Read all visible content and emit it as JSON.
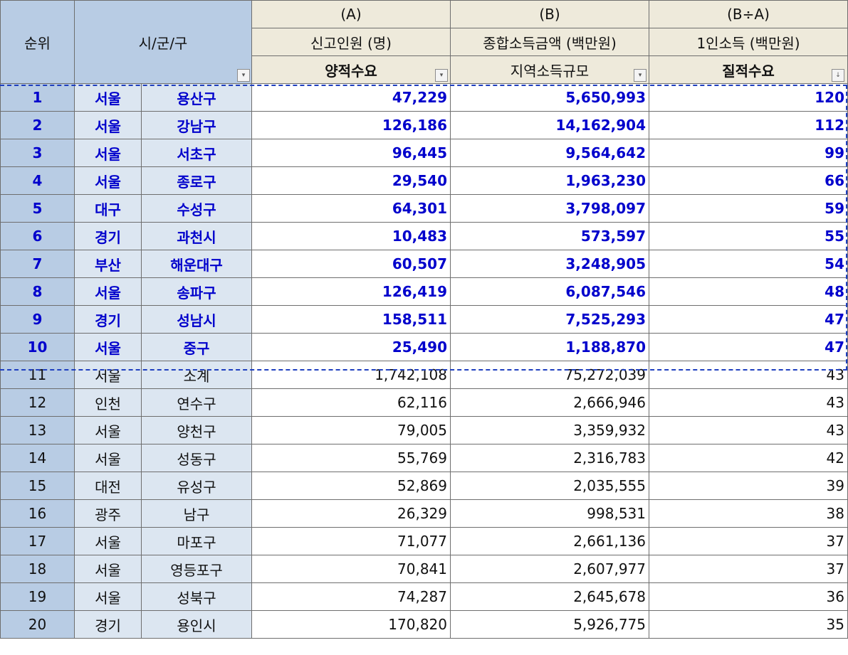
{
  "header": {
    "rank_label": "순위",
    "region_label": "시/군/구",
    "col_a": {
      "code": "(A)",
      "title": "신고인원 (명)",
      "subtitle": "양적수요"
    },
    "col_b": {
      "code": "(B)",
      "title": "종합소득금액 (백만원)",
      "subtitle": "지역소득규모"
    },
    "col_c": {
      "code": "(B÷A)",
      "title": "1인소득 (백만원)",
      "subtitle": "질적수요"
    },
    "filter_icons": {
      "region": "filter-dropdown-icon",
      "a": "filter-dropdown-icon",
      "b": "filter-dropdown-icon",
      "c": "sort-descending-icon"
    },
    "filter_glyph": "▾",
    "sort_glyph": "↓"
  },
  "rows": [
    {
      "rank": "1",
      "city": "서울",
      "district": "용산구",
      "a": "47,229",
      "b": "5,650,993",
      "c": "120"
    },
    {
      "rank": "2",
      "city": "서울",
      "district": "강남구",
      "a": "126,186",
      "b": "14,162,904",
      "c": "112"
    },
    {
      "rank": "3",
      "city": "서울",
      "district": "서초구",
      "a": "96,445",
      "b": "9,564,642",
      "c": "99"
    },
    {
      "rank": "4",
      "city": "서울",
      "district": "종로구",
      "a": "29,540",
      "b": "1,963,230",
      "c": "66"
    },
    {
      "rank": "5",
      "city": "대구",
      "district": "수성구",
      "a": "64,301",
      "b": "3,798,097",
      "c": "59"
    },
    {
      "rank": "6",
      "city": "경기",
      "district": "과천시",
      "a": "10,483",
      "b": "573,597",
      "c": "55"
    },
    {
      "rank": "7",
      "city": "부산",
      "district": "해운대구",
      "a": "60,507",
      "b": "3,248,905",
      "c": "54"
    },
    {
      "rank": "8",
      "city": "서울",
      "district": "송파구",
      "a": "126,419",
      "b": "6,087,546",
      "c": "48"
    },
    {
      "rank": "9",
      "city": "경기",
      "district": "성남시",
      "a": "158,511",
      "b": "7,525,293",
      "c": "47"
    },
    {
      "rank": "10",
      "city": "서울",
      "district": "중구",
      "a": "25,490",
      "b": "1,188,870",
      "c": "47"
    },
    {
      "rank": "11",
      "city": "서울",
      "district": "소계",
      "a": "1,742,108",
      "b": "75,272,039",
      "c": "43"
    },
    {
      "rank": "12",
      "city": "인천",
      "district": "연수구",
      "a": "62,116",
      "b": "2,666,946",
      "c": "43"
    },
    {
      "rank": "13",
      "city": "서울",
      "district": "양천구",
      "a": "79,005",
      "b": "3,359,932",
      "c": "43"
    },
    {
      "rank": "14",
      "city": "서울",
      "district": "성동구",
      "a": "55,769",
      "b": "2,316,783",
      "c": "42"
    },
    {
      "rank": "15",
      "city": "대전",
      "district": "유성구",
      "a": "52,869",
      "b": "2,035,555",
      "c": "39"
    },
    {
      "rank": "16",
      "city": "광주",
      "district": "남구",
      "a": "26,329",
      "b": "998,531",
      "c": "38"
    },
    {
      "rank": "17",
      "city": "서울",
      "district": "마포구",
      "a": "71,077",
      "b": "2,661,136",
      "c": "37"
    },
    {
      "rank": "18",
      "city": "서울",
      "district": "영등포구",
      "a": "70,841",
      "b": "2,607,977",
      "c": "37"
    },
    {
      "rank": "19",
      "city": "서울",
      "district": "성북구",
      "a": "74,287",
      "b": "2,645,678",
      "c": "36"
    },
    {
      "rank": "20",
      "city": "경기",
      "district": "용인시",
      "a": "170,820",
      "b": "5,926,775",
      "c": "35"
    }
  ],
  "highlight": {
    "top_rows": 10,
    "text_color": "#0000cc",
    "border_color": "#1f3fbf"
  },
  "colors": {
    "header_blue": "#b8cce4",
    "header_tan": "#eeeadb",
    "city_fill": "#dce6f1"
  }
}
